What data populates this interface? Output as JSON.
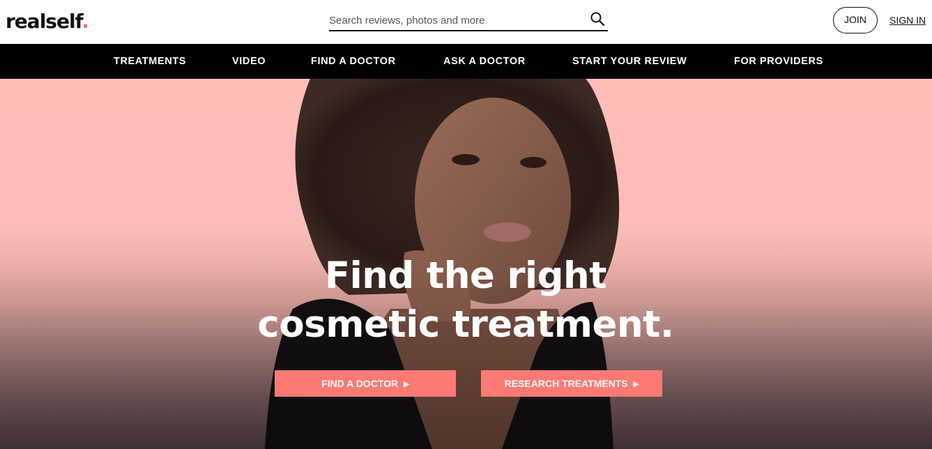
{
  "header": {
    "logo_text": "realself",
    "logo_dot": ".",
    "search_placeholder": "Search reviews, photos and more",
    "join_label": "JOIN",
    "signin_label": "SIGN IN"
  },
  "nav": {
    "items": [
      {
        "label": "TREATMENTS"
      },
      {
        "label": "VIDEO"
      },
      {
        "label": "FIND A DOCTOR"
      },
      {
        "label": "ASK A DOCTOR"
      },
      {
        "label": "START YOUR REVIEW"
      },
      {
        "label": "FOR PROVIDERS"
      }
    ]
  },
  "hero": {
    "title_line1": "Find the right",
    "title_line2": "cosmetic treatment.",
    "cta_find_doctor": "FIND A DOCTOR",
    "cta_research": "RESEARCH TREATMENTS"
  },
  "colors": {
    "accent": "#fd7a74",
    "logo_dot": "#ff6b6b",
    "nav_bg": "#000000",
    "hero_bg": "#ffbdb8"
  },
  "icons": {
    "search": "search-icon",
    "cta_arrow": "play-arrow-icon"
  }
}
